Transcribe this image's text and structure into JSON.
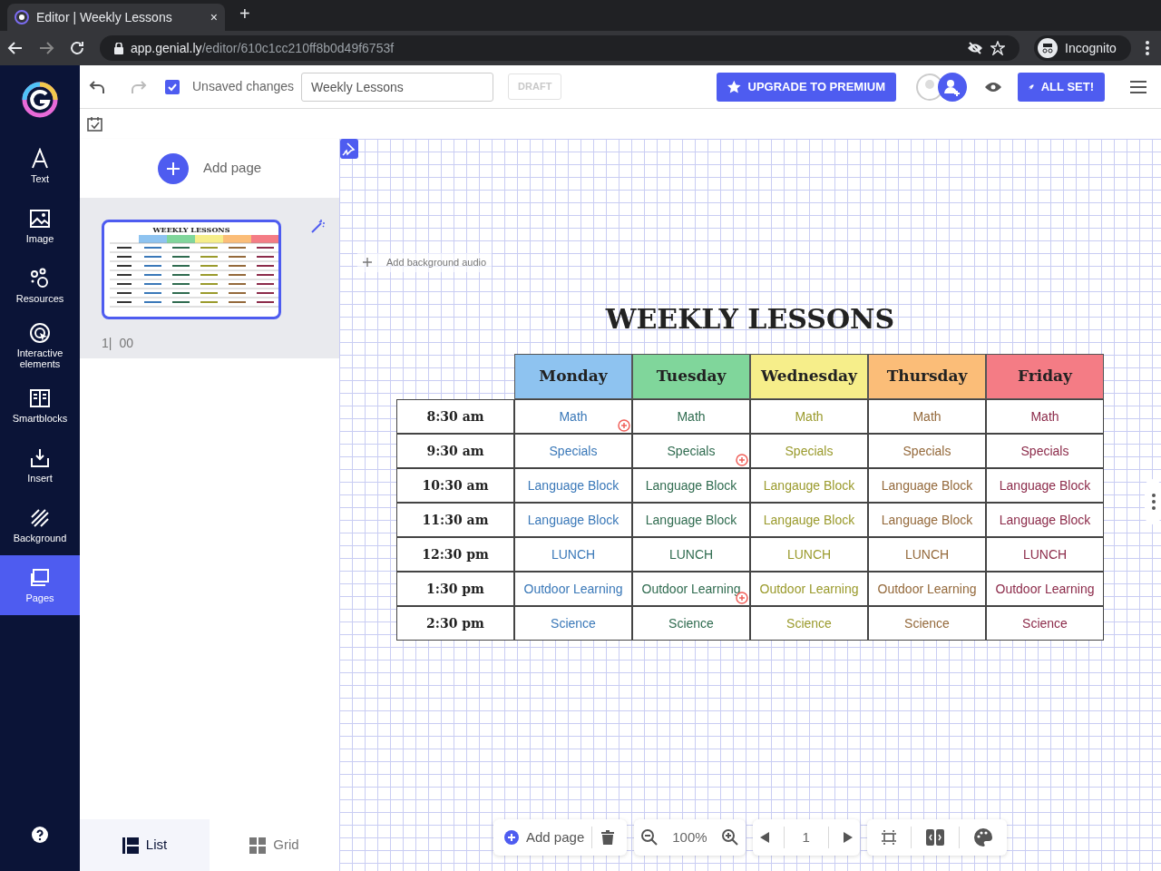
{
  "browser": {
    "tab_title": "Editor | Weekly Lessons",
    "close": "×",
    "new_tab": "+",
    "url_host": "app.genial.ly",
    "url_path": "/editor/610c1cc210ff8b0d49f6753f",
    "profile": "Incognito"
  },
  "sidebar": {
    "items": [
      {
        "label": "Text",
        "selected": false
      },
      {
        "label": "Image",
        "selected": false
      },
      {
        "label": "Resources",
        "selected": false
      },
      {
        "label": "Interactive elements",
        "selected": false
      },
      {
        "label": "Smartblocks",
        "selected": false
      },
      {
        "label": "Insert",
        "selected": false
      },
      {
        "label": "Background",
        "selected": false
      },
      {
        "label": "Pages",
        "selected": true
      }
    ]
  },
  "toolbar": {
    "status": "Unsaved changes",
    "title_value": "Weekly Lessons",
    "badge": "DRAFT",
    "upgrade": "UPGRADE TO PREMIUM",
    "publish": "ALL SET!"
  },
  "pages_panel": {
    "add_page": "Add page",
    "pages": [
      {
        "number": "1|",
        "duration": "00",
        "thumbnail_title": "WEEKLY LESSONS",
        "selected": true
      }
    ],
    "view_tabs": [
      {
        "label": "List",
        "selected": true
      },
      {
        "label": "Grid",
        "selected": false
      }
    ]
  },
  "canvas": {
    "add_audio": "Add background audio",
    "title": "WEEKLY LESSONS",
    "days": [
      {
        "name": "Monday",
        "color": "#8ec3f0"
      },
      {
        "name": "Tuesday",
        "color": "#80d69b"
      },
      {
        "name": "Wednesday",
        "color": "#f6ee8a"
      },
      {
        "name": "Thursday",
        "color": "#fbbd78"
      },
      {
        "name": "Friday",
        "color": "#f47c85"
      }
    ],
    "rows": [
      {
        "time": "8:30 am",
        "cells": [
          {
            "text": "Math",
            "color": "#3a78b8",
            "flagged": true
          },
          {
            "text": "Math",
            "color": "#2f6b4f",
            "flagged": false
          },
          {
            "text": "Math",
            "color": "#9a9a2c",
            "flagged": false
          },
          {
            "text": "Math",
            "color": "#94693b",
            "flagged": false
          },
          {
            "text": "Math",
            "color": "#8c2b4a",
            "flagged": false
          }
        ]
      },
      {
        "time": "9:30 am",
        "cells": [
          {
            "text": "Specials",
            "color": "#3a78b8",
            "flagged": false
          },
          {
            "text": "Specials",
            "color": "#2f6b4f",
            "flagged": true
          },
          {
            "text": "Specials",
            "color": "#9a9a2c",
            "flagged": false
          },
          {
            "text": "Specials",
            "color": "#94693b",
            "flagged": false
          },
          {
            "text": "Specials",
            "color": "#8c2b4a",
            "flagged": false
          }
        ]
      },
      {
        "time": "10:30 am",
        "cells": [
          {
            "text": "Language Block",
            "color": "#3a78b8",
            "flagged": false
          },
          {
            "text": "Language Block",
            "color": "#2f6b4f",
            "flagged": false
          },
          {
            "text": "Langauge Block",
            "color": "#9a9a2c",
            "flagged": false
          },
          {
            "text": "Language Block",
            "color": "#94693b",
            "flagged": false
          },
          {
            "text": "Language Block",
            "color": "#8c2b4a",
            "flagged": false
          }
        ]
      },
      {
        "time": "11:30 am",
        "cells": [
          {
            "text": "Language Block",
            "color": "#3a78b8",
            "flagged": false
          },
          {
            "text": "Language Block",
            "color": "#2f6b4f",
            "flagged": false
          },
          {
            "text": "Langauge Block",
            "color": "#9a9a2c",
            "flagged": false
          },
          {
            "text": "Language Block",
            "color": "#94693b",
            "flagged": false
          },
          {
            "text": "Language Block",
            "color": "#8c2b4a",
            "flagged": false
          }
        ]
      },
      {
        "time": "12:30 pm",
        "cells": [
          {
            "text": "LUNCH",
            "color": "#3a78b8",
            "flagged": false
          },
          {
            "text": "LUNCH",
            "color": "#2f6b4f",
            "flagged": false
          },
          {
            "text": "LUNCH",
            "color": "#9a9a2c",
            "flagged": false
          },
          {
            "text": "LUNCH",
            "color": "#94693b",
            "flagged": false
          },
          {
            "text": "LUNCH",
            "color": "#8c2b4a",
            "flagged": false
          }
        ]
      },
      {
        "time": "1:30 pm",
        "cells": [
          {
            "text": "Outdoor Learning",
            "color": "#3a78b8",
            "flagged": false
          },
          {
            "text": "Outdoor Learning",
            "color": "#2f6b4f",
            "flagged": true
          },
          {
            "text": "Outdoor Learning",
            "color": "#9a9a2c",
            "flagged": false
          },
          {
            "text": "Outdoor Learning",
            "color": "#94693b",
            "flagged": false
          },
          {
            "text": "Outdoor Learning",
            "color": "#8c2b4a",
            "flagged": false
          }
        ]
      },
      {
        "time": "2:30 pm",
        "cells": [
          {
            "text": "Science",
            "color": "#3a78b8",
            "flagged": false
          },
          {
            "text": "Science",
            "color": "#2f6b4f",
            "flagged": false
          },
          {
            "text": "Science",
            "color": "#9a9a2c",
            "flagged": false
          },
          {
            "text": "Science",
            "color": "#94693b",
            "flagged": false
          },
          {
            "text": "Science",
            "color": "#8c2b4a",
            "flagged": false
          }
        ]
      }
    ]
  },
  "bottom_bar": {
    "add_page": "Add page",
    "zoom": "100%",
    "page": "1"
  }
}
